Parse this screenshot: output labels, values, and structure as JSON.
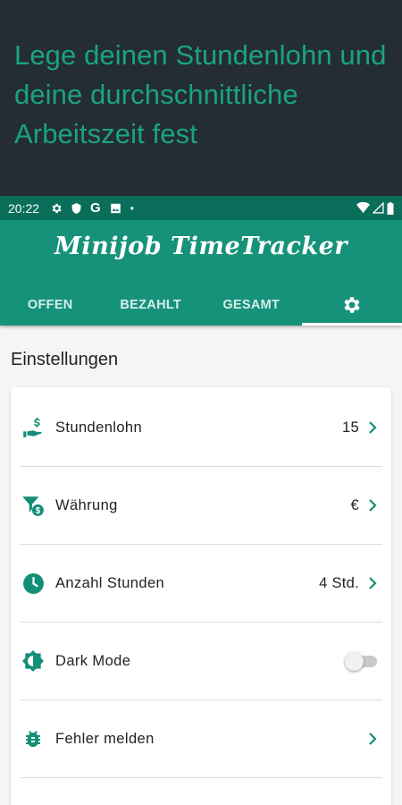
{
  "promo": {
    "text": "Lege deinen Stundenlohn und deine durchschnittliche Arbeitszeit fest"
  },
  "statusbar": {
    "time": "20:22"
  },
  "app": {
    "title": "Minijob TimeTracker"
  },
  "tabs": [
    {
      "label": "OFFEN"
    },
    {
      "label": "BEZAHLT"
    },
    {
      "label": "GESAMT"
    }
  ],
  "settings": {
    "title": "Einstellungen",
    "items": [
      {
        "label": "Stundenlohn",
        "value": "15",
        "icon": "hand-coin-icon"
      },
      {
        "label": "Währung",
        "value": "€",
        "icon": "currency-filter-icon"
      },
      {
        "label": "Anzahl Stunden",
        "value": "4 Std.",
        "icon": "clock-icon"
      },
      {
        "label": "Dark Mode",
        "toggle": false,
        "icon": "brightness-icon"
      },
      {
        "label": "Fehler melden",
        "value": "",
        "icon": "bug-icon"
      }
    ]
  },
  "colors": {
    "primary": "#16927a",
    "statusbar": "#0a6e5b",
    "promo_bg": "#242c35",
    "promo_text": "#1aa383"
  }
}
